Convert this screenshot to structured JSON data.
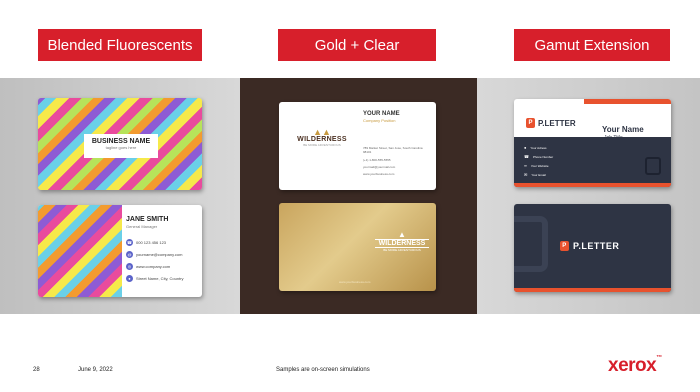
{
  "sections": [
    {
      "label": "Blended Fluorescents"
    },
    {
      "label": "Gold + Clear"
    },
    {
      "label": "Gamut Extension"
    }
  ],
  "fluorescent": {
    "card1": {
      "title": "BUSINESS NAME",
      "tagline": "tagline goes here"
    },
    "card2": {
      "name": "JANE SMITH",
      "role": "General Manager",
      "phone": "000 123 456 123",
      "email": "yourname@company.com",
      "web": "www.company.com",
      "address": "Street Name, City, Country"
    }
  },
  "gold": {
    "card1": {
      "brand": "WILDERNESS",
      "brand_tag": "BE MORE ADVENTUROUS",
      "your_name": "YOUR NAME",
      "company_position": "Company Position",
      "address": "789 Market Street, San Jose, South Carolina 98101",
      "phone": "(+1) 1-800-555-5555",
      "email": "yourmail@yourmail.com",
      "web": "www.yourbusiness.com"
    },
    "card2": {
      "brand": "WILDERNESS",
      "brand_tag": "BE MORE ADVENTUROUS",
      "web": "www.yourbusiness.com"
    }
  },
  "gamut": {
    "card1": {
      "brand": "P.LETTER",
      "your_name": "Your Name",
      "job_title": "Job Title",
      "address": "Your Adress",
      "phone": "Phone Number",
      "website": "Your Website",
      "email": "Your Email"
    },
    "card2": {
      "brand": "P.LETTER"
    }
  },
  "footer": {
    "page": "28",
    "date": "June 9, 2022",
    "note": "Samples are on-screen simulations",
    "logo": "xerox",
    "tm": "™"
  },
  "colors": {
    "accent": "#d71f2b",
    "dark_brown": "#3b2a24",
    "navy": "#2e3444",
    "orange": "#e8522e",
    "gold": "#c89a3f"
  }
}
